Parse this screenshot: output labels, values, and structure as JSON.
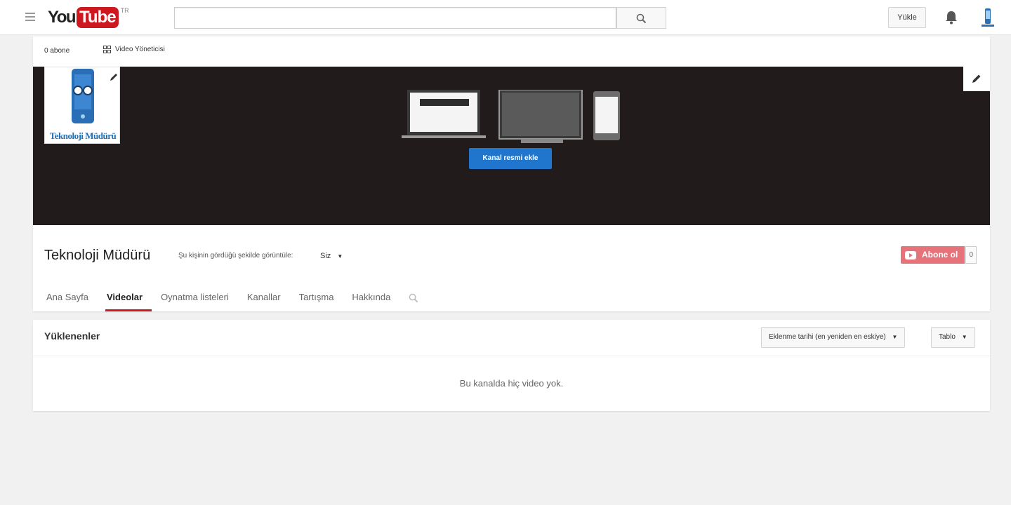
{
  "masthead": {
    "logo_you": "You",
    "logo_tube": "Tube",
    "country_code": "TR",
    "search_placeholder": "",
    "upload_label": "Yükle"
  },
  "channel": {
    "subscriber_count": "0 abone",
    "video_manager_label": "Video Yöneticisi",
    "icon_text": "Teknoloji Müdürü",
    "add_art_label": "Kanal resmi ekle",
    "title": "Teknoloji Müdürü",
    "view_as_label": "Şu kişinin gördüğü şekilde görüntüle:",
    "view_as_value": "Siz",
    "subscribe_label": "Abone ol",
    "subscribe_count": "0"
  },
  "tabs": [
    {
      "label": "Ana Sayfa",
      "active": false
    },
    {
      "label": "Videolar",
      "active": true
    },
    {
      "label": "Oynatma listeleri",
      "active": false
    },
    {
      "label": "Kanallar",
      "active": false
    },
    {
      "label": "Tartışma",
      "active": false
    },
    {
      "label": "Hakkında",
      "active": false
    }
  ],
  "uploads": {
    "title": "Yüklenenler",
    "sort_label": "Eklenme tarihi (en yeniden en eskiye)",
    "view_label": "Tablo",
    "empty_message": "Bu kanalda hiç video yok."
  },
  "colors": {
    "brand_red": "#cc181e",
    "banner_bg": "#211c1b",
    "button_blue": "#2075cc",
    "subscribe_pink": "#e7737a"
  }
}
